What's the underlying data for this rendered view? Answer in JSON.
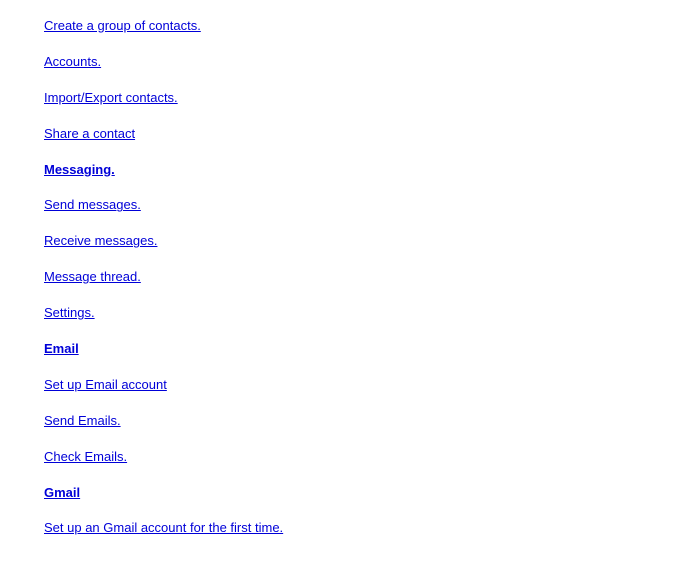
{
  "items": [
    {
      "label": "Create a group of contacts. ",
      "header": false
    },
    {
      "label": "Accounts. ",
      "header": false
    },
    {
      "label": "Import/Export contacts. ",
      "header": false
    },
    {
      "label": "Share a contact",
      "header": false
    },
    {
      "label": "Messaging. ",
      "header": true
    },
    {
      "label": "Send messages. ",
      "header": false
    },
    {
      "label": "Receive messages. ",
      "header": false
    },
    {
      "label": "Message thread. ",
      "header": false
    },
    {
      "label": "Settings. ",
      "header": false
    },
    {
      "label": "Email",
      "header": true
    },
    {
      "label": "Set up Email account",
      "header": false
    },
    {
      "label": "Send Emails. ",
      "header": false
    },
    {
      "label": "Check Emails. ",
      "header": false
    },
    {
      "label": "Gmail",
      "header": true
    },
    {
      "label": "Set up an Gmail account for the first time. ",
      "header": false
    }
  ]
}
